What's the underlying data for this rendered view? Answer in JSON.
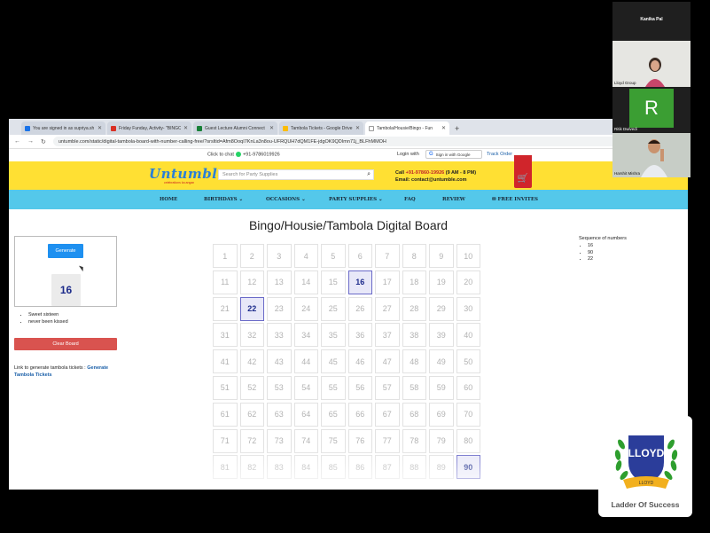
{
  "browser": {
    "tabs": [
      {
        "label": "You are signed in as supriya.sh",
        "color": "#1a73e8",
        "active": false
      },
      {
        "label": "Friday Funday, Activity- \"BINGO\"",
        "color": "#d93025",
        "active": false
      },
      {
        "label": "Guest Lecture Alumni Connect",
        "color": "#188038",
        "active": false
      },
      {
        "label": "Tambola Tickets - Google Drive",
        "color": "#fbbc04",
        "active": false
      },
      {
        "label": "Tambola/Housie/Bingo - Fun",
        "color": "#5f6368",
        "active": true
      }
    ],
    "new_tab": "+",
    "url": "untumble.com/static/digital-tambola-board-with-number-calling-free/?srsltid=Afm8OoqI7KnLa3n8ou-UFRQUH7dQM1FE-jdgOK9QDImn71j_BLFhMMOH"
  },
  "site": {
    "click_to_chat": "Click to chat",
    "whatsapp_number": "+91-9786019926",
    "login_with": "Login with",
    "google_sign_in": "Sign in with Google",
    "track_order": "Track Order",
    "logo": "Untumble",
    "logo_tagline": "celebrations ka angan",
    "search_placeholder": "Search for Party Supplies",
    "call_label": "Call",
    "call_number": "+91-97860-19926",
    "call_hours": "(9 AM - 8 PM)",
    "email_line": "Email: contact@untumble.com",
    "nav": [
      "HOME",
      "BIRTHDAYS ⌄",
      "OCCASIONS ⌄",
      "PARTY SUPPLIES ⌄",
      "FAQ",
      "REVIEW",
      "FREE INVITES"
    ]
  },
  "page": {
    "title": "Bingo/Housie/Tambola Digital Board",
    "generate_label": "Generate",
    "current_number": "16",
    "songs": [
      "Sweet sixteen",
      "never been kissed"
    ],
    "clear_label": "Clear Board",
    "link_prefix": "Link to generate tambola tickets :",
    "link_text": "Generate Tambola Tickets",
    "sequence_title": "Sequence of numbers",
    "sequence": [
      "16",
      "90",
      "22"
    ],
    "called": [
      16,
      22,
      90
    ]
  },
  "call": {
    "participants": [
      {
        "name": "Kanika Pal"
      },
      {
        "name": "Lloyd Group"
      },
      {
        "name": "Ritik Dwivedi",
        "initial": "R"
      },
      {
        "name": "Harshit Mishra"
      }
    ]
  },
  "badge": {
    "brand": "LLOYD",
    "ribbon": "LLOYD",
    "tagline": "Ladder Of Success"
  },
  "colors": {
    "header_yellow": "#ffe033",
    "nav_blue": "#54c8ea",
    "generate_blue": "#1e90f0",
    "clear_red": "#d9534f",
    "called_border": "#6a6ac8",
    "number_navy": "#1b2a8a"
  }
}
